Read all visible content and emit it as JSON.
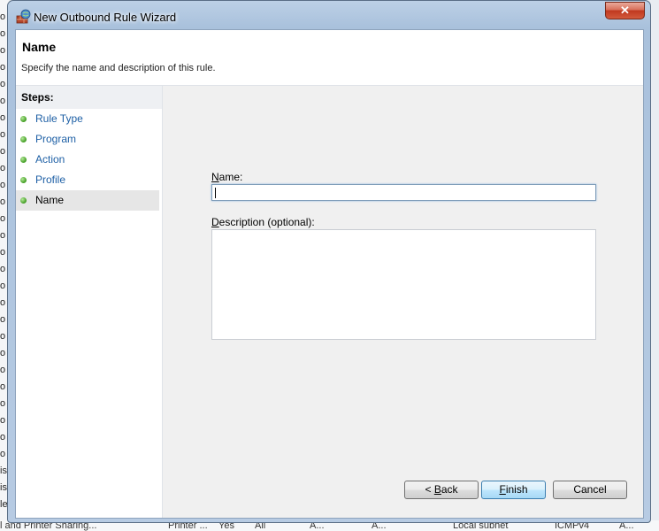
{
  "window": {
    "title": "New Outbound Rule Wizard",
    "close_glyph": "✕"
  },
  "header": {
    "title": "Name",
    "description": "Specify the name and description of this rule."
  },
  "steps": {
    "heading": "Steps:",
    "items": [
      {
        "label": "Rule Type",
        "state": "done"
      },
      {
        "label": "Program",
        "state": "done"
      },
      {
        "label": "Action",
        "state": "done"
      },
      {
        "label": "Profile",
        "state": "done"
      },
      {
        "label": "Name",
        "state": "current"
      }
    ]
  },
  "form": {
    "name_label_accel": "N",
    "name_label_rest": "ame:",
    "name_value": "",
    "description_label_accel": "D",
    "description_label_rest": "escription (optional):",
    "description_value": ""
  },
  "buttons": {
    "back_prefix": "< ",
    "back_accel": "B",
    "back_rest": "ack",
    "finish_accel": "F",
    "finish_rest": "inish",
    "cancel": "Cancel"
  },
  "background": {
    "left_column_glyphs": [
      "o",
      "o",
      "o",
      "o",
      "o",
      "o",
      "o",
      "o",
      "o",
      "o",
      "o",
      "o",
      "o",
      "o",
      "o",
      "o",
      "o",
      "o",
      "o",
      "o",
      "o",
      "o",
      "o",
      "o",
      "o",
      "o",
      "o",
      "is",
      "is",
      "le"
    ],
    "bottom_row": [
      "l and Printer Sharing...",
      "Printer ...",
      "Yes",
      "All",
      "A...",
      "A...",
      "Local subnet",
      "ICMPv4",
      "A..."
    ]
  },
  "colors": {
    "accent_link": "#1d5fa5",
    "close_button": "#c0391f",
    "step_dot": "#3e9b1f"
  }
}
